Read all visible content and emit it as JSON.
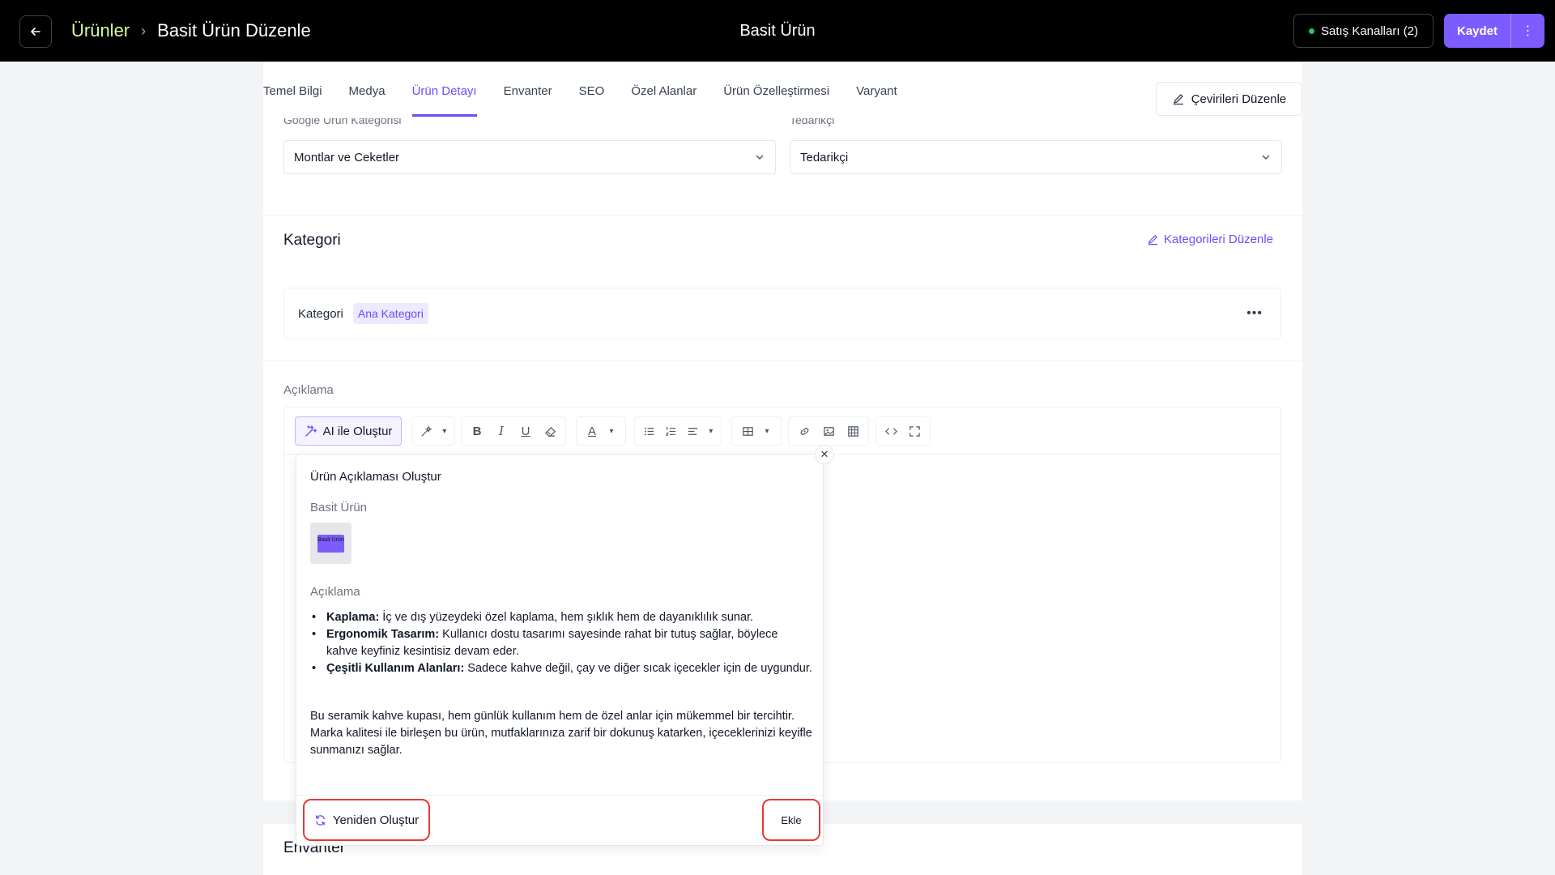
{
  "header": {
    "breadcrumb_root": "Ürünler",
    "breadcrumb_sep": "›",
    "breadcrumb_current": "Basit Ürün Düzenle",
    "page_title": "Basit Ürün",
    "channels_label": "Satış Kanalları (2)",
    "save_label": "Kaydet"
  },
  "tabs": [
    "Temel Bilgi",
    "Medya",
    "Ürün Detayı",
    "Envanter",
    "SEO",
    "Özel Alanlar",
    "Ürün Özelleştirmesi",
    "Varyant"
  ],
  "active_tab": "Ürün Detayı",
  "translations_label": "Çevirileri Düzenle",
  "fields": {
    "google_category_label": "Google Ürün Kategorisi",
    "google_category_value": "Montlar ve Ceketler",
    "supplier_label": "Tedarikçi",
    "supplier_value": "Tedarikçi"
  },
  "category_section": {
    "title": "Kategori",
    "edit_link": "Kategorileri Düzenle",
    "row_label": "Kategori",
    "chip": "Ana Kategori"
  },
  "description": {
    "label": "Açıklama",
    "ai_button": "AI ile Oluştur"
  },
  "popup": {
    "title": "Ürün Açıklaması Oluştur",
    "product_name": "Basit Ürün",
    "thumb_text": "Basit Ürün",
    "desc_label": "Açıklama",
    "bullets": [
      {
        "title": "Kaplama:",
        "text": " İç ve dış yüzeydeki özel kaplama, hem şıklık hem de dayanıklılık sunar."
      },
      {
        "title": "Ergonomik Tasarım:",
        "text": " Kullanıcı dostu tasarımı sayesinde rahat bir tutuş sağlar, böylece kahve keyfiniz kesintisiz devam eder."
      },
      {
        "title": "Çeşitli Kullanım Alanları:",
        "text": " Sadece kahve değil, çay ve diğer sıcak içecekler için de uygundur."
      }
    ],
    "paragraph": "Bu seramik kahve kupası, hem günlük kullanım hem de özel anlar için mükemmel bir tercihtir. Marka kalitesi ile birleşen bu ürün, mutfaklarınıza zarif bir dokunuş katarken, içeceklerinizi keyifle sunmanızı sağlar.",
    "regenerate_label": "Yeniden Oluştur",
    "add_label": "Ekle"
  },
  "inventory_title": "Envanter",
  "colors": {
    "accent": "#6d4aff",
    "highlight": "#e53935",
    "header_bg": "#000000"
  }
}
